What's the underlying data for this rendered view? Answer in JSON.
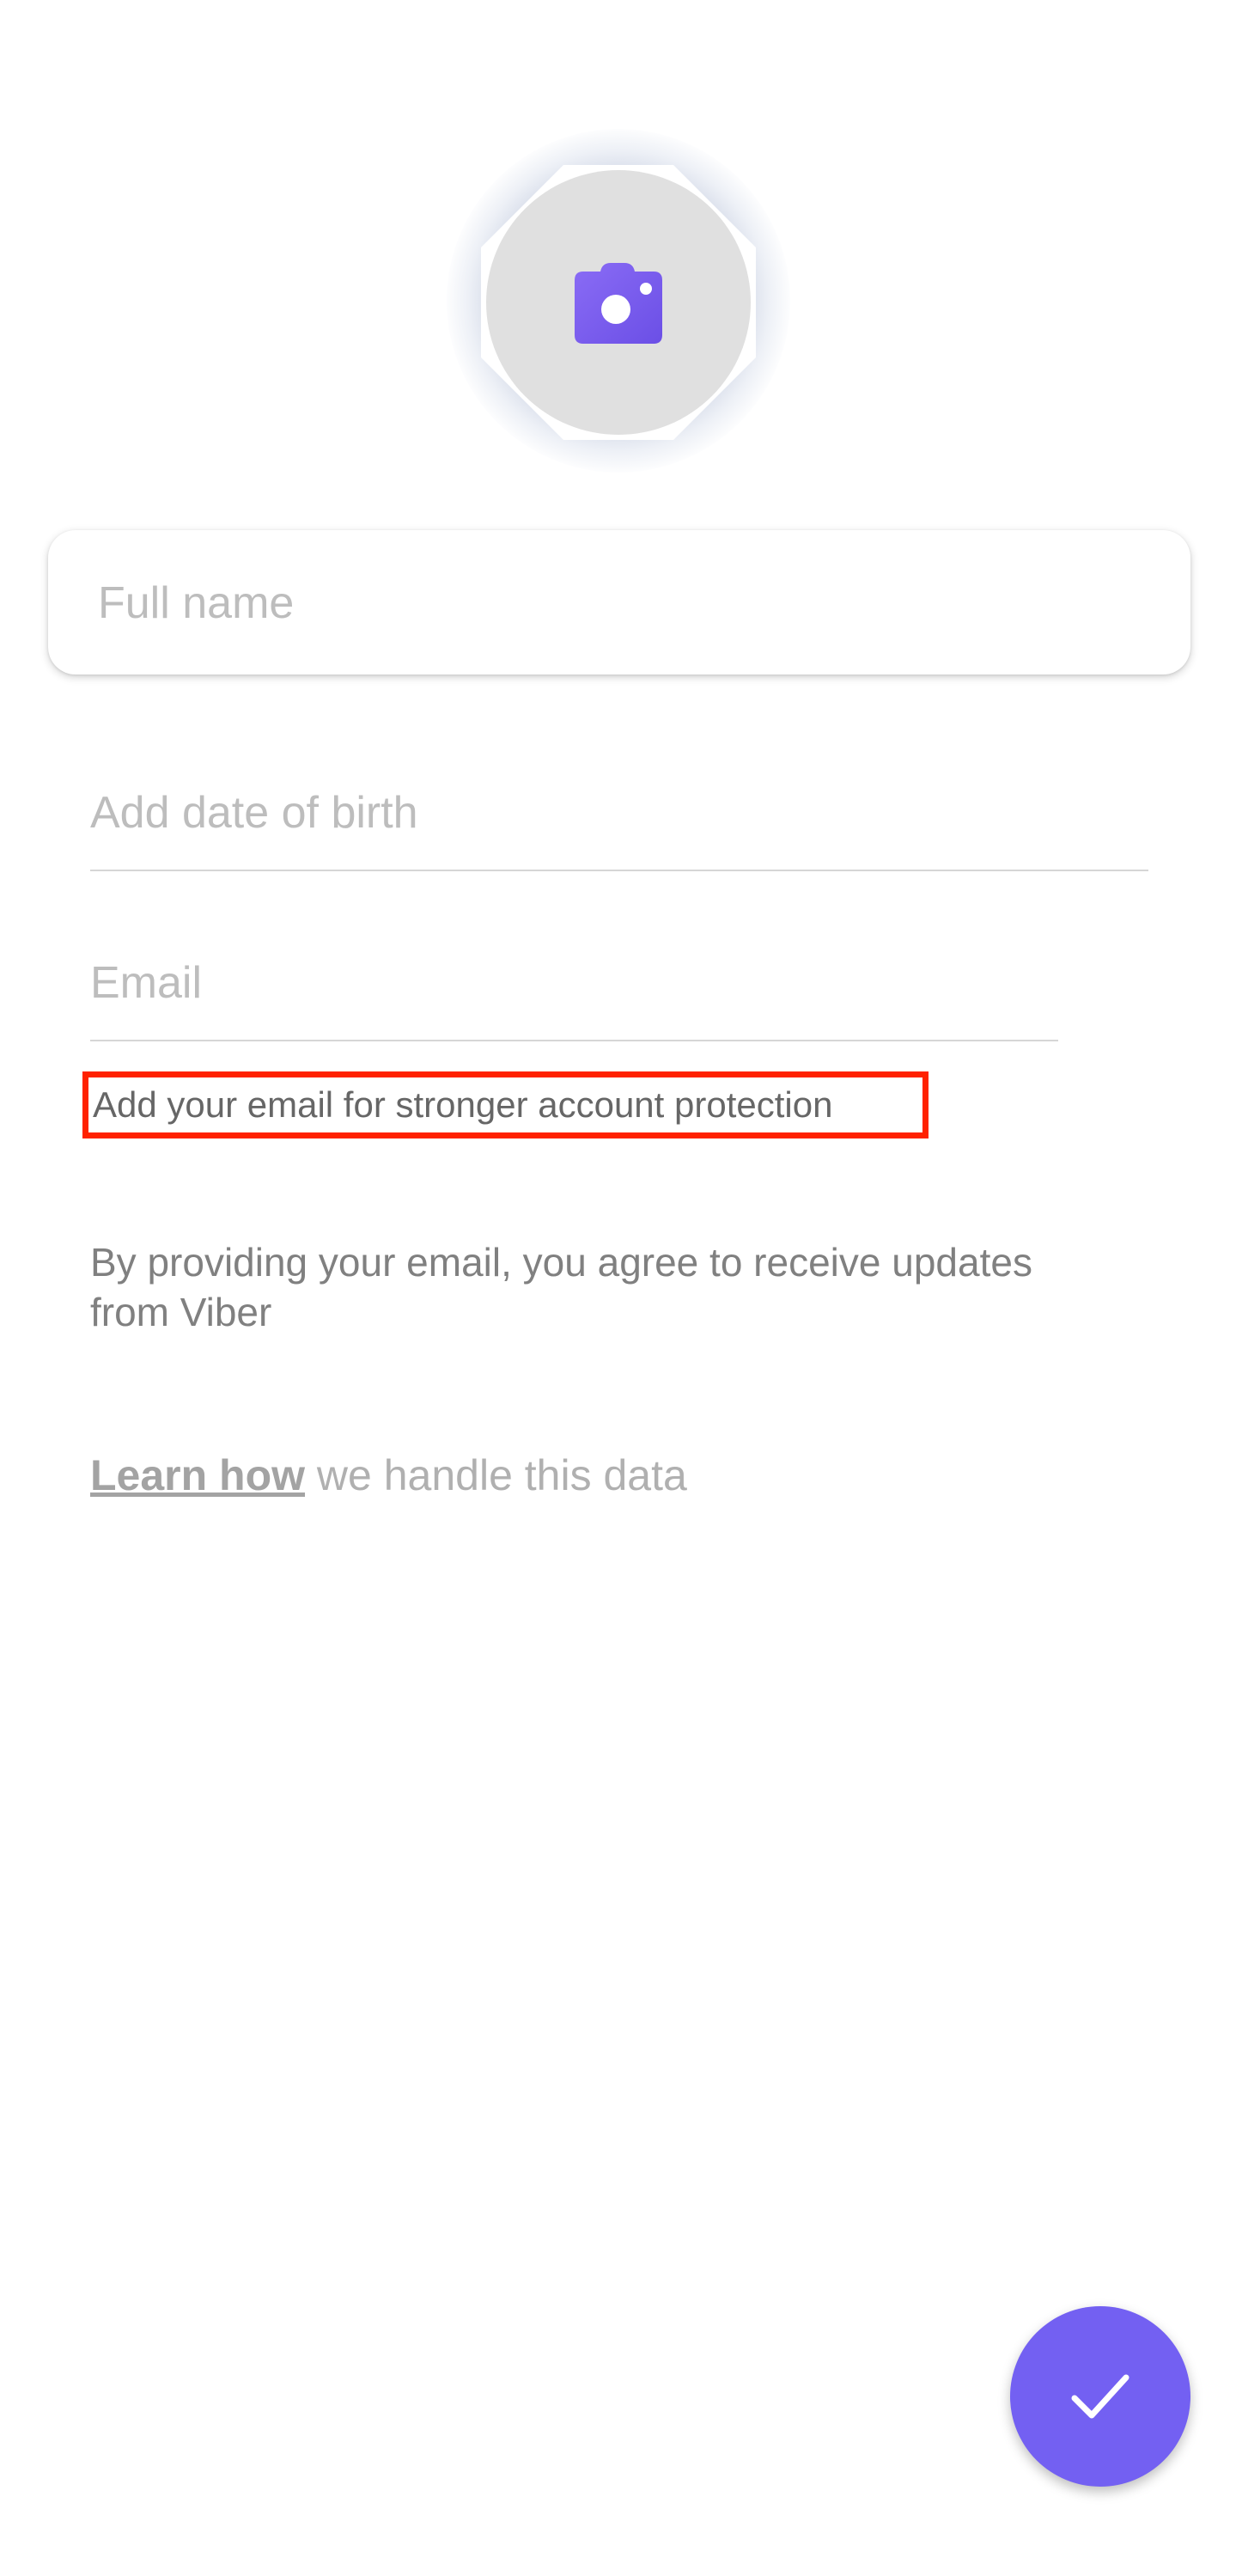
{
  "colors": {
    "accent": "#7360f2",
    "highlight": "#ff2200",
    "avatar_bg": "#e0e0e0"
  },
  "avatar": {
    "icon": "camera-icon"
  },
  "full_name": {
    "placeholder": "Full name",
    "value": ""
  },
  "date_of_birth": {
    "placeholder": "Add date of birth",
    "value": ""
  },
  "email": {
    "placeholder": "Email",
    "value": "",
    "hint": "Add your email for stronger account protection"
  },
  "consent_text": "By providing your email, you agree to receive updates from Viber",
  "learn": {
    "link_text": "Learn how",
    "rest_text": " we handle this data"
  },
  "fab": {
    "icon": "checkmark-icon"
  }
}
